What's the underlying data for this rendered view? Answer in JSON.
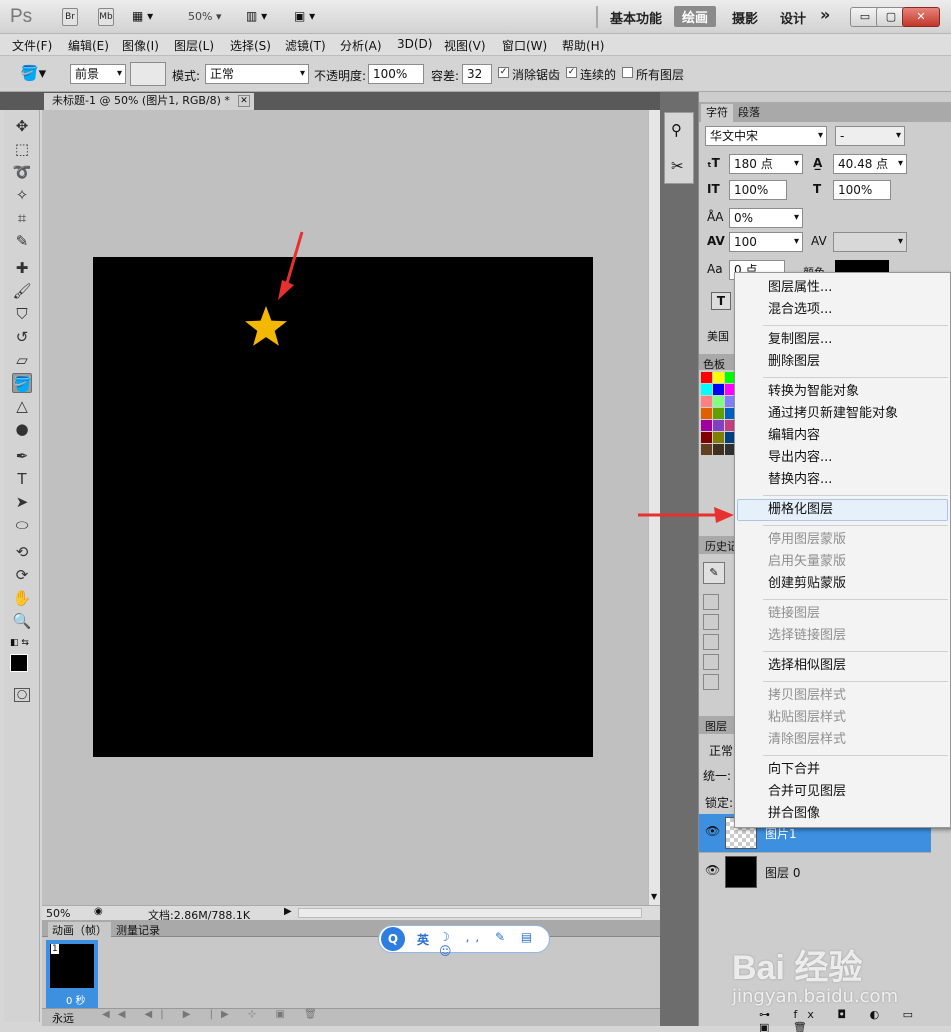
{
  "app": {
    "logo": "Ps",
    "bridge_label": "Br",
    "minibridge_label": "Mb",
    "zoom": "50%",
    "workspaces": [
      "基本功能",
      "绘画",
      "摄影",
      "设计"
    ],
    "active_workspace": "绘画",
    "more_label": "»"
  },
  "menu": [
    "文件(F)",
    "编辑(E)",
    "图像(I)",
    "图层(L)",
    "选择(S)",
    "滤镜(T)",
    "分析(A)",
    "3D(D)",
    "视图(V)",
    "窗口(W)",
    "帮助(H)"
  ],
  "options": {
    "fill_source": "前景",
    "mode_label": "模式:",
    "mode_value": "正常",
    "opacity_label": "不透明度:",
    "opacity_value": "100%",
    "tolerance_label": "容差:",
    "tolerance_value": "32",
    "antialias_label": "消除锯齿",
    "antialias_checked": true,
    "contiguous_label": "连续的",
    "contiguous_checked": true,
    "all_layers_label": "所有图层",
    "all_layers_checked": false
  },
  "document": {
    "tab_title": "未标题-1 @ 50% (图片1, RGB/8) *",
    "status_zoom": "50%",
    "doc_info": "文档:2.86M/788.1K"
  },
  "animation": {
    "tabs": [
      "动画（帧）",
      "测量记录"
    ],
    "frame_number": "1",
    "frame_delay": "0 秒",
    "loop": "永远"
  },
  "character_panel": {
    "tabs": [
      "字符",
      "段落"
    ],
    "font_family": "华文中宋",
    "font_style": "-",
    "font_size": "180 点",
    "leading": "40.48 点",
    "vertical_scale": "100%",
    "horizontal_scale": "100%",
    "baseline_shift": "0%",
    "tracking": "100",
    "baseline_value": "0 点",
    "color_label": "颜色",
    "language": "美国"
  },
  "swatches_tab": "色板",
  "history_tab": "历史记",
  "layers_panel": {
    "tab": "图层",
    "blend_mode": "正常",
    "unify_label": "统一:",
    "lock_label": "锁定:",
    "layers": [
      {
        "name": "图片1",
        "selected": true
      },
      {
        "name": "图层 0",
        "selected": false
      }
    ]
  },
  "context_menu": {
    "groups": [
      [
        {
          "label": "图层属性...",
          "enabled": true
        },
        {
          "label": "混合选项...",
          "enabled": true
        }
      ],
      [
        {
          "label": "复制图层...",
          "enabled": true
        },
        {
          "label": "删除图层",
          "enabled": true
        }
      ],
      [
        {
          "label": "转换为智能对象",
          "enabled": true
        },
        {
          "label": "通过拷贝新建智能对象",
          "enabled": true
        },
        {
          "label": "编辑内容",
          "enabled": true
        },
        {
          "label": "导出内容...",
          "enabled": true
        },
        {
          "label": "替换内容...",
          "enabled": true
        }
      ],
      [
        {
          "label": "栅格化图层",
          "enabled": true,
          "highlighted": true
        }
      ],
      [
        {
          "label": "停用图层蒙版",
          "enabled": false
        },
        {
          "label": "启用矢量蒙版",
          "enabled": false
        },
        {
          "label": "创建剪贴蒙版",
          "enabled": true
        }
      ],
      [
        {
          "label": "链接图层",
          "enabled": false
        },
        {
          "label": "选择链接图层",
          "enabled": false
        }
      ],
      [
        {
          "label": "选择相似图层",
          "enabled": true
        }
      ],
      [
        {
          "label": "拷贝图层样式",
          "enabled": false
        },
        {
          "label": "粘贴图层样式",
          "enabled": false
        },
        {
          "label": "清除图层样式",
          "enabled": false
        }
      ],
      [
        {
          "label": "向下合并",
          "enabled": true
        },
        {
          "label": "合并可见图层",
          "enabled": true
        },
        {
          "label": "拼合图像",
          "enabled": true
        }
      ]
    ]
  },
  "ime_toolbar": {
    "lang": "英"
  },
  "watermark": {
    "brand": "Bai 经验",
    "url": "jingyan.baidu.com"
  },
  "colors": {
    "canvas": "#000000",
    "star": "#f5b800",
    "arrow": "#e8312e",
    "selection": "#3d8fe0"
  }
}
